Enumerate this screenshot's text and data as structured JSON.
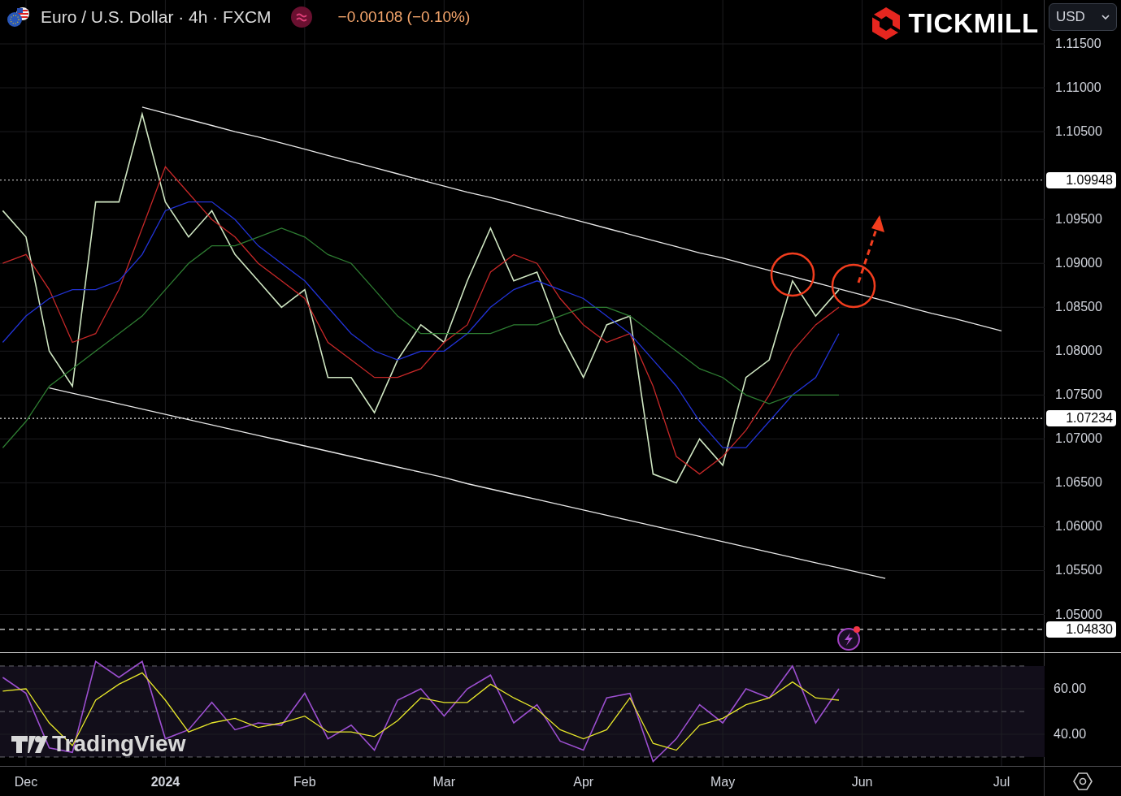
{
  "header": {
    "symbol": "Euro / U.S. Dollar · 4h · FXCM",
    "change": "−0.00108 (−0.10%)"
  },
  "brand": {
    "name": "TICKMILL"
  },
  "currency_select": {
    "value": "USD"
  },
  "chart_logo": {
    "text": "TradingView"
  },
  "price_chart": {
    "chart_data": {
      "type": "line",
      "categories": [
        null,
        "Dec",
        null,
        null,
        null,
        null,
        null,
        "2024",
        null,
        null,
        null,
        null,
        null,
        "Feb",
        null,
        null,
        null,
        null,
        null,
        "Mar",
        null,
        null,
        null,
        null,
        null,
        "Apr",
        null,
        null,
        null,
        null,
        null,
        "May",
        null,
        null,
        null,
        null,
        null,
        "Jun",
        null,
        null,
        null,
        null,
        null,
        "Jul"
      ],
      "series": [
        {
          "color": "#cfe6c2",
          "values": [
            1.096,
            1.093,
            1.08,
            1.076,
            1.097,
            1.097,
            1.107,
            1.097,
            1.093,
            1.096,
            1.091,
            1.088,
            1.085,
            1.087,
            1.077,
            1.077,
            1.073,
            1.079,
            1.083,
            1.081,
            1.088,
            1.094,
            1.088,
            1.089,
            1.082,
            1.077,
            1.083,
            1.084,
            1.066,
            1.065,
            1.07,
            1.067,
            1.077,
            1.079,
            1.088,
            1.084,
            1.087,
            null,
            null,
            null,
            null,
            null,
            null,
            null
          ]
        },
        {
          "color": "#c62828",
          "values": [
            1.09,
            1.091,
            1.087,
            1.081,
            1.082,
            1.087,
            1.094,
            1.101,
            1.098,
            1.095,
            1.093,
            1.09,
            1.088,
            1.086,
            1.081,
            1.079,
            1.077,
            1.077,
            1.078,
            1.081,
            1.083,
            1.089,
            1.091,
            1.09,
            1.086,
            1.083,
            1.081,
            1.082,
            1.076,
            1.068,
            1.066,
            1.068,
            1.071,
            1.075,
            1.08,
            1.083,
            1.085,
            null,
            null,
            null,
            null,
            null,
            null,
            null
          ]
        },
        {
          "color": "#2233d6",
          "values": [
            1.081,
            1.084,
            1.086,
            1.087,
            1.087,
            1.088,
            1.091,
            1.096,
            1.097,
            1.097,
            1.095,
            1.092,
            1.09,
            1.088,
            1.085,
            1.082,
            1.08,
            1.079,
            1.08,
            1.08,
            1.082,
            1.085,
            1.087,
            1.088,
            1.087,
            1.086,
            1.084,
            1.082,
            1.079,
            1.076,
            1.072,
            1.069,
            1.069,
            1.072,
            1.075,
            1.077,
            1.082,
            null,
            null,
            null,
            null,
            null,
            null,
            null
          ]
        },
        {
          "color": "#2e7d32",
          "values": [
            1.069,
            1.072,
            1.076,
            1.078,
            1.08,
            1.082,
            1.084,
            1.087,
            1.09,
            1.092,
            1.092,
            1.093,
            1.094,
            1.093,
            1.091,
            1.09,
            1.087,
            1.084,
            1.082,
            1.082,
            1.082,
            1.082,
            1.083,
            1.083,
            1.084,
            1.085,
            1.085,
            1.084,
            1.082,
            1.08,
            1.078,
            1.077,
            1.075,
            1.074,
            1.075,
            1.075,
            1.075,
            null,
            null,
            null,
            null,
            null,
            null,
            null
          ]
        },
        {
          "color": "#e8e8e8",
          "values": [
            null,
            null,
            null,
            null,
            null,
            null,
            1.1078,
            1.1071,
            1.1064,
            1.1057,
            1.105,
            1.1044,
            1.1037,
            1.103,
            1.1023,
            1.1016,
            1.1009,
            1.1002,
            1.0995,
            1.0988,
            1.0981,
            1.0975,
            1.0968,
            1.0961,
            1.0954,
            1.0947,
            1.094,
            1.0933,
            1.0926,
            1.0919,
            1.0912,
            1.0906,
            1.0899,
            1.0892,
            1.0885,
            1.0878,
            1.0871,
            1.0864,
            1.0857,
            1.085,
            1.0843,
            1.0837,
            1.083,
            1.0823
          ]
        },
        {
          "color": "#e8e8e8",
          "values": [
            null,
            null,
            1.0758,
            1.0752,
            1.0746,
            1.074,
            1.0734,
            1.0728,
            1.0722,
            1.0716,
            1.071,
            1.0704,
            1.0698,
            1.0692,
            1.0686,
            1.068,
            1.0674,
            1.0668,
            1.0662,
            1.0656,
            1.0649,
            1.0643,
            1.0637,
            1.0631,
            1.0625,
            1.0619,
            1.0613,
            1.0607,
            1.0601,
            1.0595,
            1.0589,
            1.0583,
            1.0577,
            1.0571,
            1.0565,
            1.0559,
            1.0553,
            1.0547,
            1.0541,
            null,
            null,
            null,
            null,
            null
          ]
        }
      ],
      "ylim": [
        1.0457,
        1.12
      ],
      "yticks": [
        {
          "value": 1.05,
          "label": "1.05000"
        },
        {
          "value": 1.055,
          "label": "1.05500"
        },
        {
          "value": 1.06,
          "label": "1.06000"
        },
        {
          "value": 1.065,
          "label": "1.06500"
        },
        {
          "value": 1.07,
          "label": "1.07000"
        },
        {
          "value": 1.075,
          "label": "1.07500"
        },
        {
          "value": 1.08,
          "label": "1.08000"
        },
        {
          "value": 1.085,
          "label": "1.08500"
        },
        {
          "value": 1.09,
          "label": "1.09000"
        },
        {
          "value": 1.095,
          "label": "1.09500"
        },
        {
          "value": 1.105,
          "label": "1.10500"
        },
        {
          "value": 1.11,
          "label": "1.11000"
        },
        {
          "value": 1.115,
          "label": "1.11500"
        }
      ],
      "ref_lines": [
        {
          "axis": "y",
          "value": 1.09948,
          "label": "1.09948"
        },
        {
          "axis": "y",
          "value": 1.07234,
          "label": "1.07234"
        },
        {
          "axis": "y",
          "value": 1.0483,
          "label": "1.04830"
        }
      ],
      "grid": true
    }
  },
  "rsi_chart": {
    "chart_data": {
      "type": "line",
      "series": [
        {
          "color": "#9c4fd0",
          "values": [
            65,
            58,
            34,
            32,
            72,
            65,
            72,
            38,
            42,
            54,
            42,
            45,
            44,
            58,
            38,
            44,
            33,
            55,
            60,
            48,
            60,
            66,
            45,
            53,
            37,
            33,
            56,
            58,
            28,
            38,
            53,
            45,
            60,
            56,
            70,
            45,
            60,
            null,
            null,
            null,
            null,
            null,
            null,
            null
          ]
        },
        {
          "color": "#e6e62a",
          "values": [
            59,
            60,
            45,
            35,
            55,
            62,
            67,
            55,
            41,
            45,
            47,
            43,
            45,
            48,
            41,
            41,
            39,
            46,
            56,
            54,
            54,
            62,
            56,
            51,
            42,
            38,
            42,
            56,
            36,
            33,
            44,
            47,
            53,
            56,
            63,
            56,
            55,
            null,
            null,
            null,
            null,
            null,
            null,
            null
          ]
        }
      ],
      "ylim": [
        25.7,
        75.7
      ],
      "yticks": [
        {
          "value": 40,
          "label": "40.00"
        },
        {
          "value": 60,
          "label": "60.00"
        }
      ],
      "grid": true
    }
  }
}
